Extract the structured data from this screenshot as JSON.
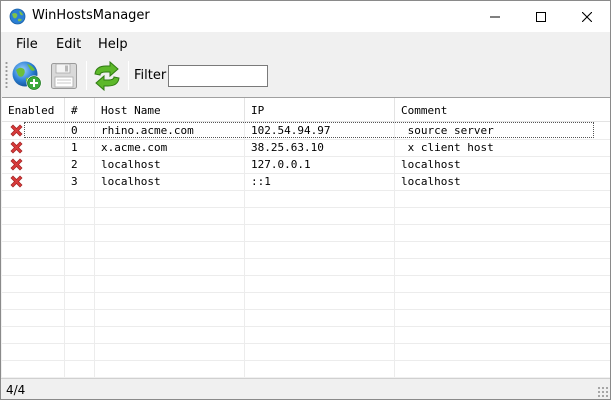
{
  "window": {
    "title": "WinHostsManager"
  },
  "menu": {
    "file": "File",
    "edit": "Edit",
    "help": "Help"
  },
  "toolbar": {
    "add_icon": "globe-add-icon",
    "save_icon": "floppy-disk-icon",
    "refresh_icon": "refresh-arrows-icon",
    "filter_label": "Filter",
    "filter_value": ""
  },
  "grid": {
    "columns": [
      "Enabled",
      "#",
      "Host Name",
      "IP",
      "Comment"
    ],
    "rows": [
      {
        "enabled_icon": "red-x-icon",
        "num": "0",
        "host": "rhino.acme.com",
        "ip": "102.54.94.97",
        "comment": " source server"
      },
      {
        "enabled_icon": "red-x-icon",
        "num": "1",
        "host": "x.acme.com",
        "ip": "38.25.63.10",
        "comment": " x client host"
      },
      {
        "enabled_icon": "red-x-icon",
        "num": "2",
        "host": "localhost",
        "ip": "127.0.0.1",
        "comment": "localhost"
      },
      {
        "enabled_icon": "red-x-icon",
        "num": "3",
        "host": "localhost",
        "ip": "::1",
        "comment": "localhost"
      }
    ]
  },
  "status": {
    "text": "4/4"
  },
  "colors": {
    "disabled_red": "#d83b3b",
    "globe_blue": "#2a7fd4",
    "add_green": "#3aaa3a",
    "refresh_green": "#5db82a"
  }
}
